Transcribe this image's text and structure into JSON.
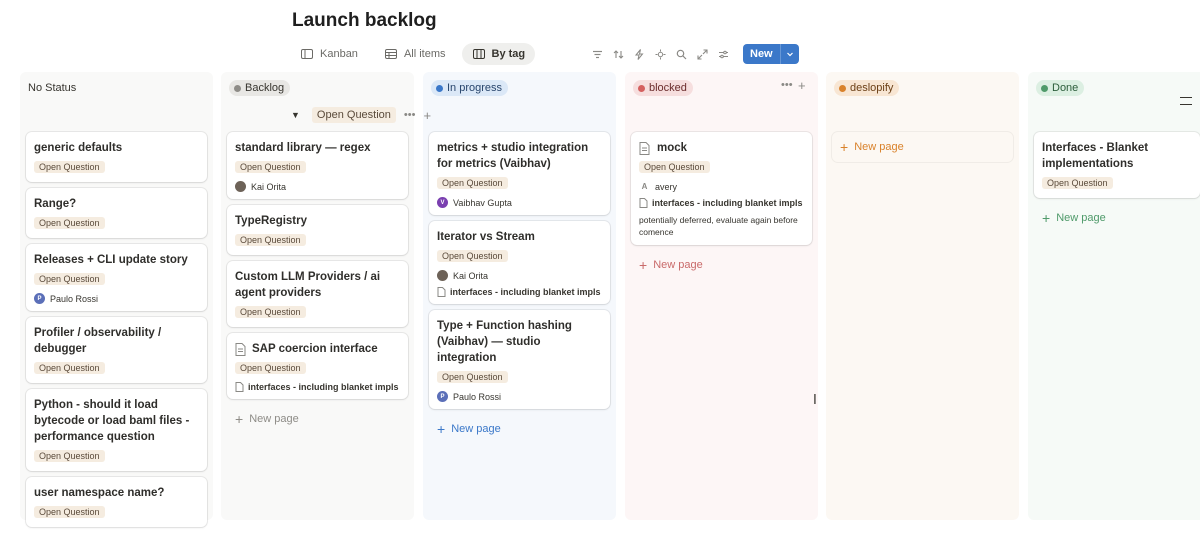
{
  "page": {
    "title": "Launch backlog"
  },
  "views": [
    {
      "label": "Kanban",
      "icon": "board-icon"
    },
    {
      "label": "All items",
      "icon": "table-icon"
    },
    {
      "label": "By tag",
      "icon": "columns-icon"
    }
  ],
  "toolbar": {
    "new_label": "New"
  },
  "subgroup": {
    "label": "Open Question"
  },
  "columns": [
    {
      "label": "No Status"
    },
    {
      "label": "Backlog"
    },
    {
      "label": "In progress"
    },
    {
      "label": "blocked"
    },
    {
      "label": "deslopify"
    },
    {
      "label": "Done"
    }
  ],
  "cards": {
    "c0": [
      {
        "title": "generic defaults",
        "tag": "Open Question"
      },
      {
        "title": "Range?",
        "tag": "Open Question"
      },
      {
        "title": "Releases + CLI update story",
        "tag": "Open Question",
        "person": "Paulo Rossi",
        "initial": "P"
      },
      {
        "title": "Profiler / observability / debugger",
        "tag": "Open Question"
      },
      {
        "title": "Python - should it load bytecode or load baml files - performance question",
        "tag": "Open Question"
      },
      {
        "title": "user namespace name?",
        "tag": "Open Question"
      }
    ],
    "c1": [
      {
        "title": "standard library — regex",
        "tag": "Open Question",
        "person": "Kai Orita"
      },
      {
        "title": "TypeRegistry",
        "tag": "Open Question"
      },
      {
        "title": "Custom LLM Providers / ai agent providers",
        "tag": "Open Question"
      },
      {
        "title": "SAP coercion interface",
        "tag": "Open Question",
        "rel": "interfaces - including blanket impls"
      }
    ],
    "c2": [
      {
        "title": "metrics + studio integration for metrics (Vaibhav)",
        "tag": "Open Question",
        "person": "Vaibhav Gupta",
        "initial": "V"
      },
      {
        "title": "Iterator vs Stream",
        "tag": "Open Question",
        "person": "Kai Orita",
        "rel": "interfaces - including blanket impls"
      },
      {
        "title": "Type + Function hashing (Vaibhav) — studio integration",
        "tag": "Open Question",
        "person": "Paulo Rossi",
        "initial": "P"
      }
    ],
    "c3": [
      {
        "title": "mock",
        "tag": "Open Question",
        "person": "avery",
        "initial": "A",
        "rel": "interfaces - including blanket impls",
        "note": "potentially deferred, evaluate again before comence"
      }
    ],
    "c5": [
      {
        "title": "Interfaces - Blanket implementations",
        "tag": "Open Question"
      }
    ]
  },
  "new_page_label": "New page",
  "colors": {
    "accent": "#3b78c9",
    "done_green": "#4f9a6a",
    "orange": "#d9822b"
  }
}
